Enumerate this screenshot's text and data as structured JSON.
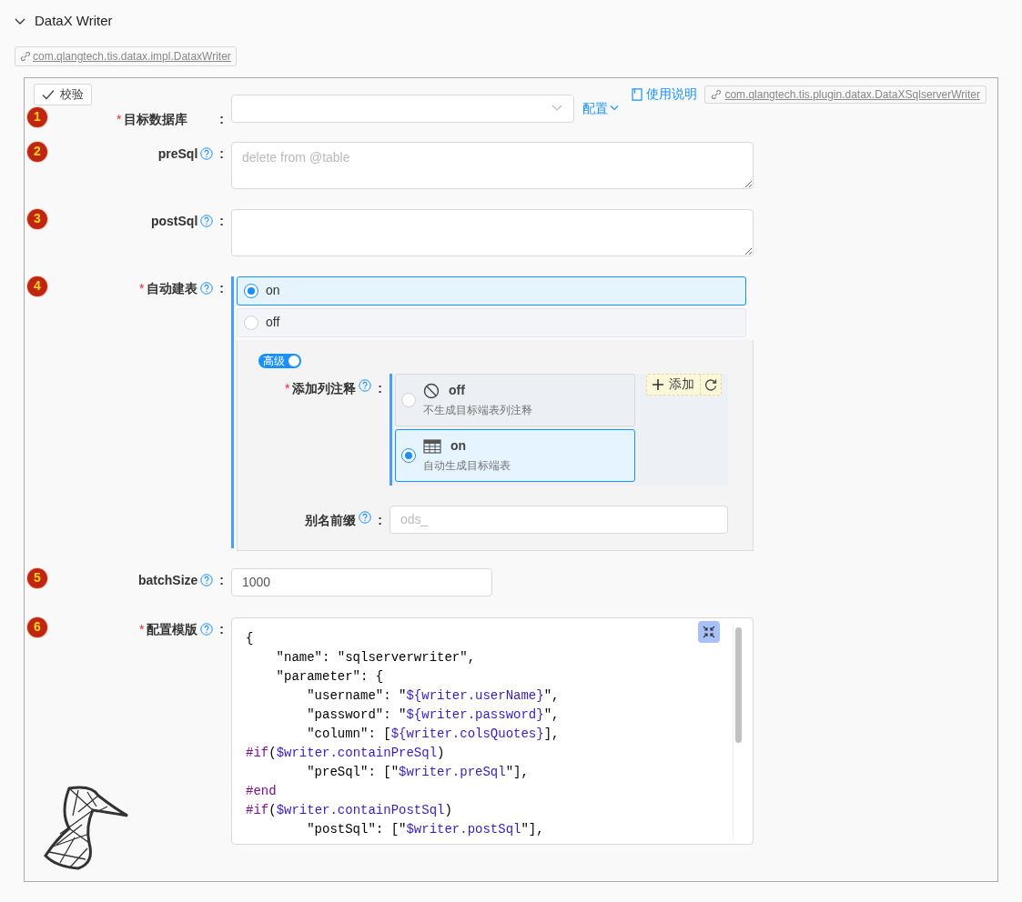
{
  "section": {
    "title": "DataX Writer",
    "expanded": true
  },
  "impl_link": "com.qlangtech.tis.datax.impl.DataxWriter",
  "panel": {
    "validate_button": "校验",
    "help_link": "使用说明",
    "plugin_link": "com.qlangtech.tis.plugin.datax.DataXSqlserverWriter"
  },
  "fields": [
    {
      "kind": "select",
      "index": "1",
      "label": "目标数据库",
      "required_mark": "*",
      "help": false,
      "colon": ":",
      "action": "配置"
    },
    {
      "kind": "textarea",
      "index": "2",
      "label": "preSql",
      "help": true,
      "colon": ":",
      "placeholder": "delete from @table"
    },
    {
      "kind": "textarea",
      "index": "3",
      "label": "postSql",
      "help": true,
      "colon": ":"
    },
    {
      "kind": "radio_group",
      "index": "4",
      "label": "自动建表",
      "required_mark": "*",
      "help": true,
      "colon": ":",
      "options": [
        {
          "label": "on",
          "selected": true
        },
        {
          "label": "off",
          "selected": false
        }
      ],
      "subform": {
        "advanced_toggle": {
          "label": "高级",
          "on": true
        },
        "fields": [
          {
            "kind": "card_radio",
            "label": "添加列注释",
            "required_mark": "*",
            "help": true,
            "colon": ":",
            "add_button": "添加",
            "options": [
              {
                "title": "off",
                "description": "不生成目标端表列注释",
                "selected": false
              },
              {
                "title": "on",
                "description": "自动生成目标端表",
                "selected": true
              }
            ]
          },
          {
            "kind": "input",
            "label": "别名前缀",
            "help": true,
            "colon": ":",
            "placeholder": "ods_"
          }
        ]
      }
    },
    {
      "kind": "input",
      "index": "5",
      "label": "batchSize",
      "help": true,
      "colon": ":",
      "value": "1000"
    },
    {
      "kind": "code",
      "index": "6",
      "label": "配置模版",
      "required_mark": "*",
      "help": true,
      "colon": ":",
      "code_lines": [
        [
          {
            "kind": "plain",
            "text": "{"
          }
        ],
        [
          {
            "kind": "plain",
            "text": "    \"name\": \"sqlserverwriter\","
          }
        ],
        [
          {
            "kind": "plain",
            "text": "    \"parameter\": {"
          }
        ],
        [
          {
            "kind": "plain",
            "text": "        \"username\": \""
          },
          {
            "kind": "var",
            "text": "${writer.userName}"
          },
          {
            "kind": "plain",
            "text": "\","
          }
        ],
        [
          {
            "kind": "plain",
            "text": "        \"password\": \""
          },
          {
            "kind": "var",
            "text": "${writer.password}"
          },
          {
            "kind": "plain",
            "text": "\","
          }
        ],
        [
          {
            "kind": "plain",
            "text": "        \"column\": ["
          },
          {
            "kind": "var",
            "text": "${writer.colsQuotes}"
          },
          {
            "kind": "plain",
            "text": "],"
          }
        ],
        [
          {
            "kind": "directive",
            "text": "#if"
          },
          {
            "kind": "plain",
            "text": "("
          },
          {
            "kind": "var",
            "text": "$writer.containPreSql"
          },
          {
            "kind": "plain",
            "text": ")"
          }
        ],
        [
          {
            "kind": "plain",
            "text": "        \"preSql\": [\""
          },
          {
            "kind": "var",
            "text": "$writer.preSql"
          },
          {
            "kind": "plain",
            "text": "\"],"
          }
        ],
        [
          {
            "kind": "directive",
            "text": "#end"
          }
        ],
        [
          {
            "kind": "directive",
            "text": "#if"
          },
          {
            "kind": "plain",
            "text": "("
          },
          {
            "kind": "var",
            "text": "$writer.containPostSql"
          },
          {
            "kind": "plain",
            "text": ")"
          }
        ],
        [
          {
            "kind": "plain",
            "text": "        \"postSql\": [\""
          },
          {
            "kind": "var",
            "text": "$writer.postSql"
          },
          {
            "kind": "plain",
            "text": "\"],"
          }
        ]
      ]
    }
  ]
}
